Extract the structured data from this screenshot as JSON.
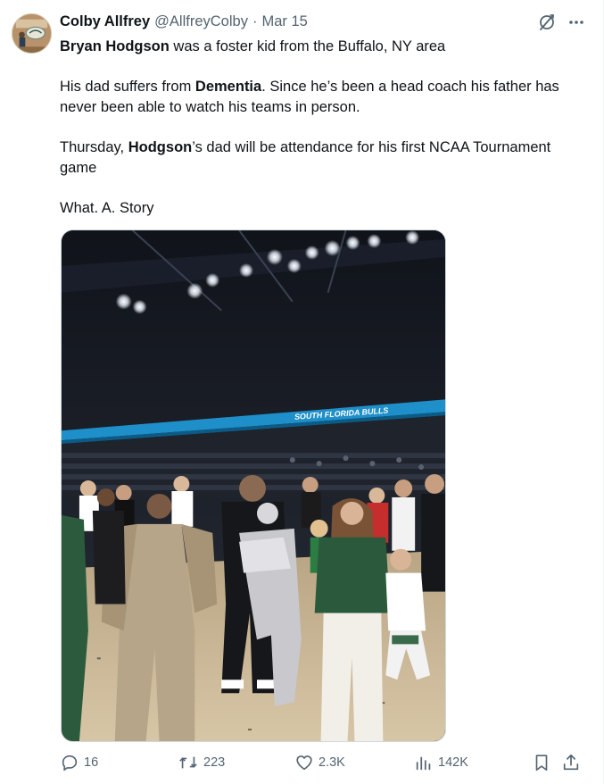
{
  "author": {
    "display_name": "Colby Allfrey",
    "handle": "@AllfreyColby",
    "separator": "·",
    "date": "Mar 15"
  },
  "tweet": {
    "line1_bold": "Bryan Hodgson",
    "line1_rest": " was a foster kid from the Buffalo, NY area",
    "line2_start": "His dad suffers from ",
    "line2_bold": "Dementia",
    "line2_rest": ". Since he’s been a head coach his father has never been able to watch his teams in person.",
    "line3_start": "Thursday, ",
    "line3_bold": "Hodgson",
    "line3_rest": "’s dad will be attendance for his first NCAA Tournament game",
    "line4": "What. A. Story"
  },
  "photo": {
    "banner_text": "SOUTH FLORIDA BULLS"
  },
  "actions": {
    "replies": "16",
    "reposts": "223",
    "likes": "2.3K",
    "views": "142K"
  },
  "icons": {
    "top": [
      "grok-icon",
      "more-icon"
    ],
    "actions": [
      "reply-icon",
      "retweet-icon",
      "like-icon",
      "views-icon",
      "bookmark-icon",
      "share-icon"
    ]
  },
  "colors": {
    "text": "#0f1419",
    "muted": "#536471",
    "border": "#cfd9de",
    "banner": "#1e8fc8"
  }
}
